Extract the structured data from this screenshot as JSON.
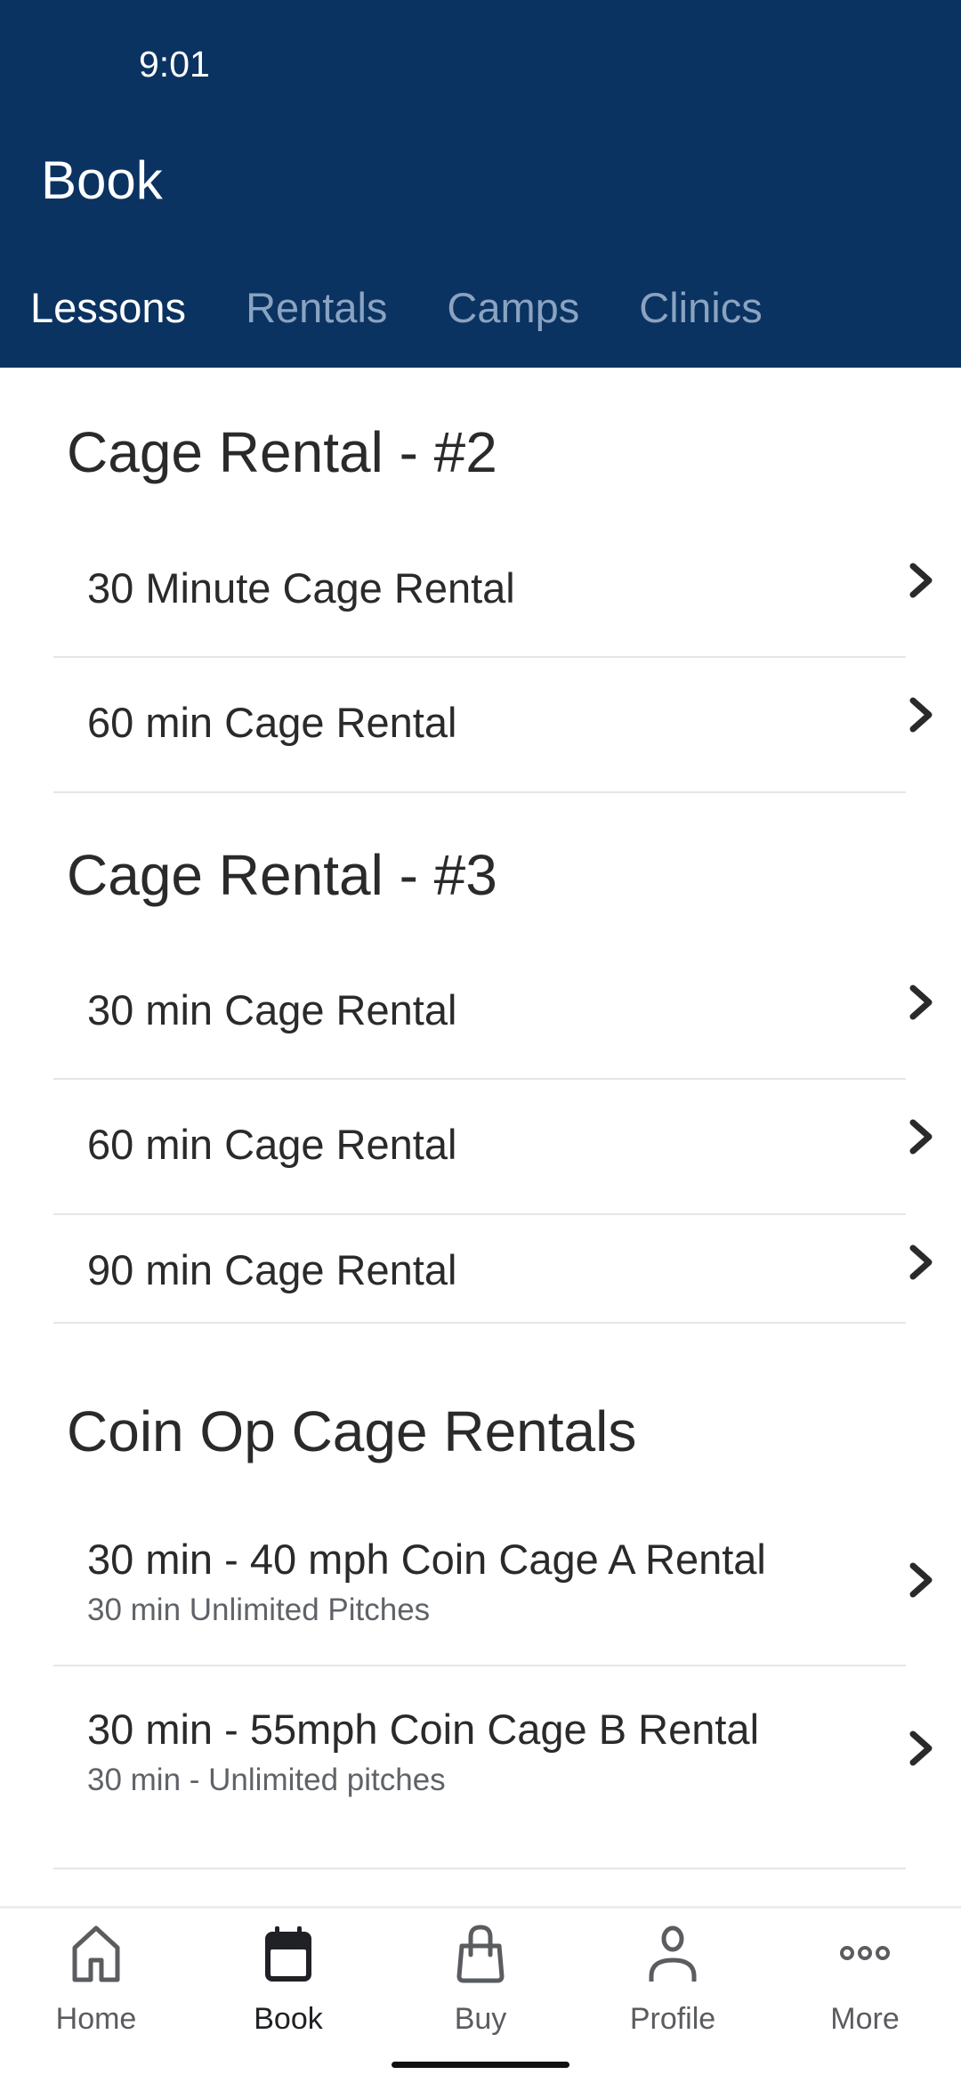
{
  "status_bar": {
    "time": "9:01"
  },
  "header": {
    "title": "Book",
    "tabs": [
      {
        "label": "Lessons",
        "active": true
      },
      {
        "label": "Rentals",
        "active": false
      },
      {
        "label": "Camps",
        "active": false
      },
      {
        "label": "Clinics",
        "active": false
      }
    ]
  },
  "sections": [
    {
      "heading": "Cage Rental - #2",
      "items": [
        {
          "title": "30 Minute Cage Rental"
        },
        {
          "title": "60 min Cage Rental"
        }
      ]
    },
    {
      "heading": "Cage Rental - #3",
      "items": [
        {
          "title": "30 min Cage Rental"
        },
        {
          "title": "60 min Cage Rental"
        },
        {
          "title": "90 min Cage Rental"
        }
      ]
    },
    {
      "heading": "Coin Op Cage Rentals",
      "items": [
        {
          "title": "30 min - 40 mph Coin Cage A Rental",
          "subtitle": "30 min Unlimited Pitches"
        },
        {
          "title": "30 min - 55mph Coin Cage B Rental",
          "subtitle": "30 min - Unlimited pitches"
        }
      ]
    }
  ],
  "bottom_nav": [
    {
      "label": "Home",
      "icon": "home-icon",
      "active": false
    },
    {
      "label": "Book",
      "icon": "calendar-icon",
      "active": true
    },
    {
      "label": "Buy",
      "icon": "shopping-bag-icon",
      "active": false
    },
    {
      "label": "Profile",
      "icon": "person-icon",
      "active": false
    },
    {
      "label": "More",
      "icon": "more-dots-icon",
      "active": false
    }
  ],
  "colors": {
    "header_bg": "#0b3361",
    "tab_active": "#ffffff",
    "tab_inactive": "#8aa3c1",
    "nav_active": "#202124",
    "nav_inactive": "#5a5c60"
  }
}
